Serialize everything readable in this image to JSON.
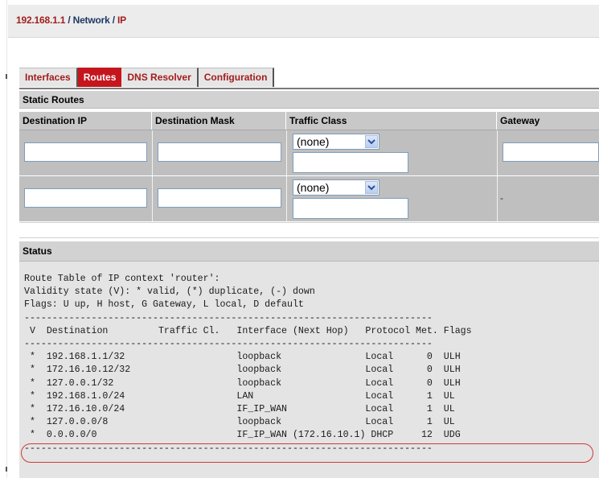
{
  "breadcrumb": {
    "host": "192.168.1.1",
    "sep1": " / ",
    "section": "Network",
    "sep2": " / ",
    "page": "IP"
  },
  "tabs": [
    {
      "label": "Interfaces",
      "active": false
    },
    {
      "label": "Routes",
      "active": true
    },
    {
      "label": "DNS Resolver",
      "active": false
    },
    {
      "label": "Configuration",
      "active": false
    }
  ],
  "static_routes": {
    "title": "Static Routes",
    "columns": [
      "Destination IP",
      "Destination Mask",
      "Traffic Class",
      "Gateway"
    ],
    "rows": [
      {
        "destination_ip": "",
        "destination_mask": "",
        "traffic_class": "(none)",
        "traffic_class_text": "",
        "gateway": ""
      },
      {
        "destination_ip": "",
        "destination_mask": "",
        "traffic_class": "(none)",
        "traffic_class_text": "",
        "gateway": "-"
      }
    ]
  },
  "status": {
    "title": "Status",
    "route_table_text": "Route Table of IP context 'router':\nValidity state (V): * valid, (*) duplicate, (-) down\nFlags: U up, H host, G Gateway, L local, D default\n-------------------------------------------------------------------------\n V  Destination         Traffic Cl.   Interface (Next Hop)   Protocol Met. Flags\n-------------------------------------------------------------------------\n *  192.168.1.1/32                    loopback               Local      0  ULH\n *  172.16.10.12/32                   loopback               Local      0  ULH\n *  127.0.0.1/32                      loopback               Local      0  ULH\n *  192.168.1.0/24                    LAN                    Local      1  UL\n *  172.16.10.0/24                    IF_IP_WAN              Local      1  UL\n *  127.0.0.0/8                       loopback               Local      1  UL\n *  0.0.0.0/0                         IF_IP_WAN (172.16.10.1) DHCP     12  UDG\n-------------------------------------------------------------------------"
  },
  "colors": {
    "active_tab": "#c5161d",
    "tab_text": "#a31d1d",
    "highlight": "#d23838"
  },
  "icons": {
    "select_arrow": "chevron-down-icon"
  }
}
